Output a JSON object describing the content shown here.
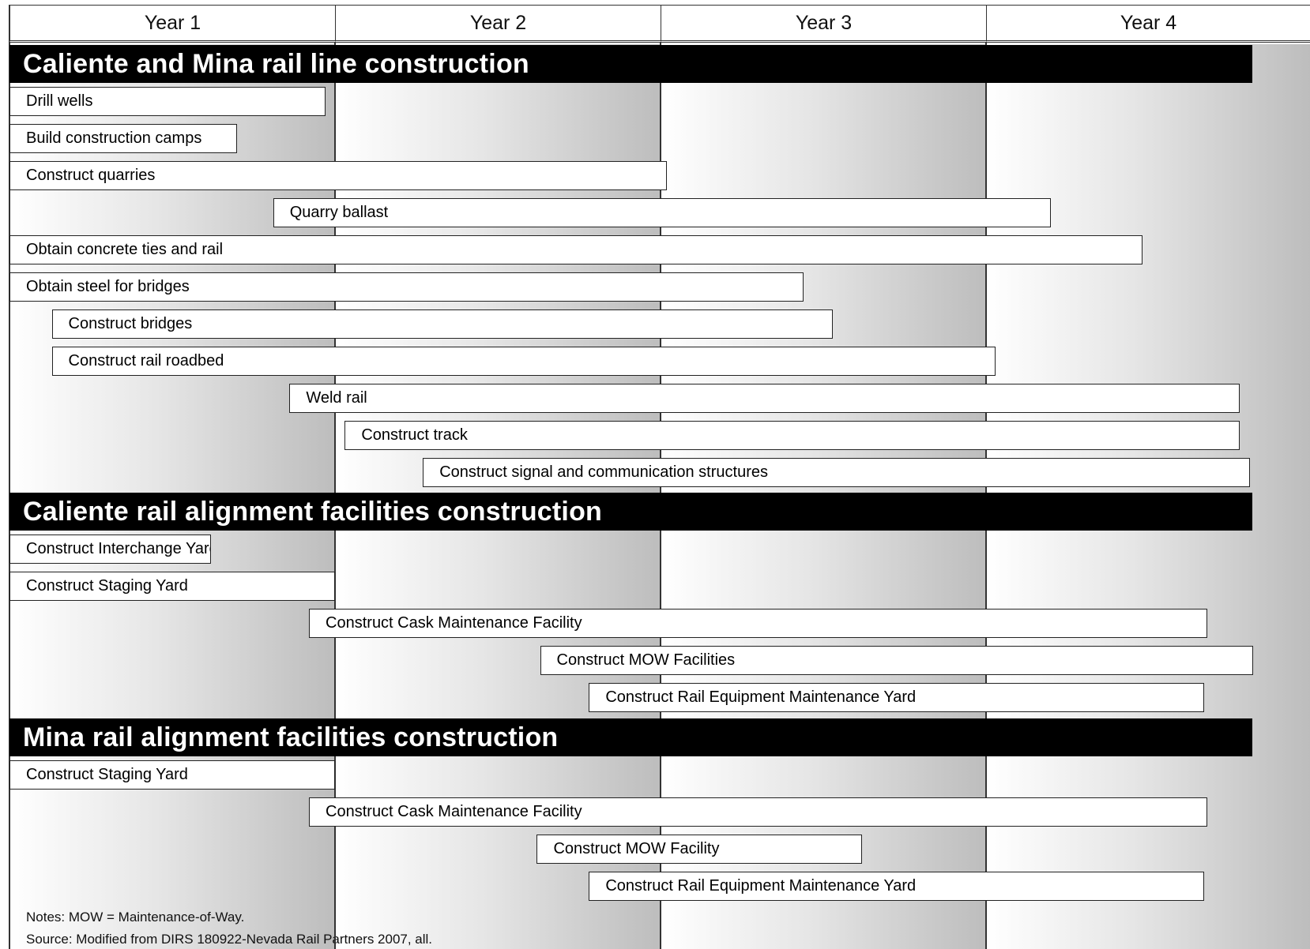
{
  "chart_data": {
    "type": "gantt",
    "columns": [
      "Year 1",
      "Year 2",
      "Year 3",
      "Year 4"
    ],
    "x_units": "years",
    "xlim": [
      0,
      4
    ],
    "sections": [
      {
        "title": "Caliente and Mina rail line construction",
        "tasks": [
          {
            "label": "Drill wells",
            "start": 0.0,
            "end": 0.97
          },
          {
            "label": "Build construction camps",
            "start": 0.0,
            "end": 0.7
          },
          {
            "label": "Construct quarries",
            "start": 0.0,
            "end": 2.02
          },
          {
            "label": "Quarry ballast",
            "start": 0.81,
            "end": 3.2
          },
          {
            "label": "Obtain concrete ties and rail",
            "start": 0.0,
            "end": 3.48
          },
          {
            "label": "Obtain steel for bridges",
            "start": 0.0,
            "end": 2.44
          },
          {
            "label": "Construct bridges",
            "start": 0.13,
            "end": 2.53
          },
          {
            "label": "Construct rail roadbed",
            "start": 0.13,
            "end": 3.03
          },
          {
            "label": "Weld rail",
            "start": 0.86,
            "end": 3.78
          },
          {
            "label": "Construct track",
            "start": 1.03,
            "end": 3.78
          },
          {
            "label": "Construct signal and communication structures",
            "start": 1.27,
            "end": 3.81
          }
        ]
      },
      {
        "title": "Caliente rail alignment facilities construction",
        "tasks": [
          {
            "label": "Construct Interchange Yard",
            "start": 0.0,
            "end": 0.62
          },
          {
            "label": "Construct Staging Yard",
            "start": 0.0,
            "end": 1.0
          },
          {
            "label": "Construct Cask Maintenance Facility",
            "start": 0.92,
            "end": 3.68
          },
          {
            "label": "Construct MOW Facilities",
            "start": 1.63,
            "end": 3.82
          },
          {
            "label": "Construct Rail Equipment Maintenance Yard",
            "start": 1.78,
            "end": 3.67
          }
        ]
      },
      {
        "title": "Mina rail alignment facilities construction",
        "tasks": [
          {
            "label": "Construct Staging Yard",
            "start": 0.0,
            "end": 1.0
          },
          {
            "label": "Construct Cask Maintenance Facility",
            "start": 0.92,
            "end": 3.68
          },
          {
            "label": "Construct MOW Facility",
            "start": 1.62,
            "end": 2.62
          },
          {
            "label": "Construct Rail Equipment Maintenance Yard",
            "start": 1.78,
            "end": 3.67
          }
        ]
      }
    ],
    "notes": "Notes:  MOW = Maintenance-of-Way.",
    "source": "Source:  Modified from DIRS 180922-Nevada Rail Partners 2007, all."
  }
}
